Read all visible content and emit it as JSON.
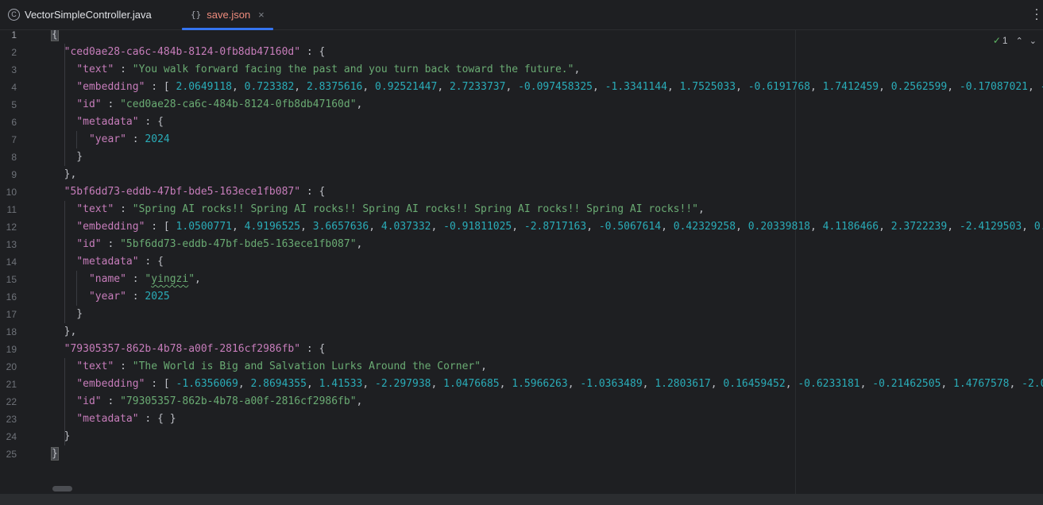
{
  "tabs": [
    {
      "label": "VectorSimpleController.java",
      "icon": "class-icon",
      "glyph": "C",
      "active": false
    },
    {
      "label": "save.json",
      "icon": "json-icon",
      "glyph": "{}",
      "active": true,
      "close": "×"
    }
  ],
  "inspection": {
    "count": "1"
  },
  "colors": {
    "key": "#c77dbb",
    "string": "#6aab73",
    "number": "#2aacb8",
    "punct": "#bcbec4",
    "accent": "#3574f0",
    "active_tab_text": "#ef8c7d"
  },
  "lines": [
    {
      "n": "1",
      "tokens": [
        {
          "t": "p",
          "v": "{"
        }
      ]
    },
    {
      "n": "2",
      "tokens": [
        {
          "t": "p",
          "v": "  "
        },
        {
          "t": "k",
          "v": "\"ced0ae28-ca6c-484b-8124-0fb8db47160d\""
        },
        {
          "t": "p",
          "v": " : {"
        }
      ]
    },
    {
      "n": "3",
      "tokens": [
        {
          "t": "p",
          "v": "    "
        },
        {
          "t": "k",
          "v": "\"text\""
        },
        {
          "t": "p",
          "v": " : "
        },
        {
          "t": "s",
          "v": "\"You walk forward facing the past and you turn back toward the future.\""
        },
        {
          "t": "p",
          "v": ","
        }
      ]
    },
    {
      "n": "4",
      "tokens": [
        {
          "t": "p",
          "v": "    "
        },
        {
          "t": "k",
          "v": "\"embedding\""
        },
        {
          "t": "p",
          "v": " : [ "
        },
        {
          "t": "n",
          "v": "2.0649118"
        },
        {
          "t": "p",
          "v": ", "
        },
        {
          "t": "n",
          "v": "0.723382"
        },
        {
          "t": "p",
          "v": ", "
        },
        {
          "t": "n",
          "v": "2.8375616"
        },
        {
          "t": "p",
          "v": ", "
        },
        {
          "t": "n",
          "v": "0.92521447"
        },
        {
          "t": "p",
          "v": ", "
        },
        {
          "t": "n",
          "v": "2.7233737"
        },
        {
          "t": "p",
          "v": ", "
        },
        {
          "t": "n",
          "v": "-0.097458325"
        },
        {
          "t": "p",
          "v": ", "
        },
        {
          "t": "n",
          "v": "-1.3341144"
        },
        {
          "t": "p",
          "v": ", "
        },
        {
          "t": "n",
          "v": "1.7525033"
        },
        {
          "t": "p",
          "v": ", "
        },
        {
          "t": "n",
          "v": "-0.6191768"
        },
        {
          "t": "p",
          "v": ", "
        },
        {
          "t": "n",
          "v": "1.7412459"
        },
        {
          "t": "p",
          "v": ", "
        },
        {
          "t": "n",
          "v": "0.2562599"
        },
        {
          "t": "p",
          "v": ", "
        },
        {
          "t": "n",
          "v": "-0.17087021"
        },
        {
          "t": "p",
          "v": ", "
        },
        {
          "t": "n",
          "v": "-"
        }
      ]
    },
    {
      "n": "5",
      "tokens": [
        {
          "t": "p",
          "v": "    "
        },
        {
          "t": "k",
          "v": "\"id\""
        },
        {
          "t": "p",
          "v": " : "
        },
        {
          "t": "s",
          "v": "\"ced0ae28-ca6c-484b-8124-0fb8db47160d\""
        },
        {
          "t": "p",
          "v": ","
        }
      ]
    },
    {
      "n": "6",
      "tokens": [
        {
          "t": "p",
          "v": "    "
        },
        {
          "t": "k",
          "v": "\"metadata\""
        },
        {
          "t": "p",
          "v": " : {"
        }
      ]
    },
    {
      "n": "7",
      "tokens": [
        {
          "t": "p",
          "v": "      "
        },
        {
          "t": "k",
          "v": "\"year\""
        },
        {
          "t": "p",
          "v": " : "
        },
        {
          "t": "n",
          "v": "2024"
        }
      ]
    },
    {
      "n": "8",
      "tokens": [
        {
          "t": "p",
          "v": "    }"
        }
      ]
    },
    {
      "n": "9",
      "tokens": [
        {
          "t": "p",
          "v": "  },"
        }
      ]
    },
    {
      "n": "10",
      "tokens": [
        {
          "t": "p",
          "v": "  "
        },
        {
          "t": "k",
          "v": "\"5bf6dd73-eddb-47bf-bde5-163ece1fb087\""
        },
        {
          "t": "p",
          "v": " : {"
        }
      ]
    },
    {
      "n": "11",
      "tokens": [
        {
          "t": "p",
          "v": "    "
        },
        {
          "t": "k",
          "v": "\"text\""
        },
        {
          "t": "p",
          "v": " : "
        },
        {
          "t": "s",
          "v": "\"Spring AI rocks!! Spring AI rocks!! Spring AI rocks!! Spring AI rocks!! Spring AI rocks!!\""
        },
        {
          "t": "p",
          "v": ","
        }
      ]
    },
    {
      "n": "12",
      "tokens": [
        {
          "t": "p",
          "v": "    "
        },
        {
          "t": "k",
          "v": "\"embedding\""
        },
        {
          "t": "p",
          "v": " : [ "
        },
        {
          "t": "n",
          "v": "1.0500771"
        },
        {
          "t": "p",
          "v": ", "
        },
        {
          "t": "n",
          "v": "4.9196525"
        },
        {
          "t": "p",
          "v": ", "
        },
        {
          "t": "n",
          "v": "3.6657636"
        },
        {
          "t": "p",
          "v": ", "
        },
        {
          "t": "n",
          "v": "4.037332"
        },
        {
          "t": "p",
          "v": ", "
        },
        {
          "t": "n",
          "v": "-0.91811025"
        },
        {
          "t": "p",
          "v": ", "
        },
        {
          "t": "n",
          "v": "-2.8717163"
        },
        {
          "t": "p",
          "v": ", "
        },
        {
          "t": "n",
          "v": "-0.5067614"
        },
        {
          "t": "p",
          "v": ", "
        },
        {
          "t": "n",
          "v": "0.42329258"
        },
        {
          "t": "p",
          "v": ", "
        },
        {
          "t": "n",
          "v": "0.20339818"
        },
        {
          "t": "p",
          "v": ", "
        },
        {
          "t": "n",
          "v": "4.1186466"
        },
        {
          "t": "p",
          "v": ", "
        },
        {
          "t": "n",
          "v": "2.3722239"
        },
        {
          "t": "p",
          "v": ", "
        },
        {
          "t": "n",
          "v": "-2.4129503"
        },
        {
          "t": "p",
          "v": ", "
        },
        {
          "t": "n",
          "v": "0."
        }
      ]
    },
    {
      "n": "13",
      "tokens": [
        {
          "t": "p",
          "v": "    "
        },
        {
          "t": "k",
          "v": "\"id\""
        },
        {
          "t": "p",
          "v": " : "
        },
        {
          "t": "s",
          "v": "\"5bf6dd73-eddb-47bf-bde5-163ece1fb087\""
        },
        {
          "t": "p",
          "v": ","
        }
      ]
    },
    {
      "n": "14",
      "tokens": [
        {
          "t": "p",
          "v": "    "
        },
        {
          "t": "k",
          "v": "\"metadata\""
        },
        {
          "t": "p",
          "v": " : {"
        }
      ]
    },
    {
      "n": "15",
      "tokens": [
        {
          "t": "p",
          "v": "      "
        },
        {
          "t": "k",
          "v": "\"name\""
        },
        {
          "t": "p",
          "v": " : "
        },
        {
          "t": "s",
          "v": "\""
        },
        {
          "t": "sq",
          "v": "yingzi"
        },
        {
          "t": "s",
          "v": "\""
        },
        {
          "t": "p",
          "v": ","
        }
      ]
    },
    {
      "n": "16",
      "tokens": [
        {
          "t": "p",
          "v": "      "
        },
        {
          "t": "k",
          "v": "\"year\""
        },
        {
          "t": "p",
          "v": " : "
        },
        {
          "t": "n",
          "v": "2025"
        }
      ]
    },
    {
      "n": "17",
      "tokens": [
        {
          "t": "p",
          "v": "    }"
        }
      ]
    },
    {
      "n": "18",
      "tokens": [
        {
          "t": "p",
          "v": "  },"
        }
      ]
    },
    {
      "n": "19",
      "tokens": [
        {
          "t": "p",
          "v": "  "
        },
        {
          "t": "k",
          "v": "\"79305357-862b-4b78-a00f-2816cf2986fb\""
        },
        {
          "t": "p",
          "v": " : {"
        }
      ]
    },
    {
      "n": "20",
      "tokens": [
        {
          "t": "p",
          "v": "    "
        },
        {
          "t": "k",
          "v": "\"text\""
        },
        {
          "t": "p",
          "v": " : "
        },
        {
          "t": "s",
          "v": "\"The World is Big and Salvation Lurks Around the Corner\""
        },
        {
          "t": "p",
          "v": ","
        }
      ]
    },
    {
      "n": "21",
      "tokens": [
        {
          "t": "p",
          "v": "    "
        },
        {
          "t": "k",
          "v": "\"embedding\""
        },
        {
          "t": "p",
          "v": " : [ "
        },
        {
          "t": "n",
          "v": "-1.6356069"
        },
        {
          "t": "p",
          "v": ", "
        },
        {
          "t": "n",
          "v": "2.8694355"
        },
        {
          "t": "p",
          "v": ", "
        },
        {
          "t": "n",
          "v": "1.41533"
        },
        {
          "t": "p",
          "v": ", "
        },
        {
          "t": "n",
          "v": "-2.297938"
        },
        {
          "t": "p",
          "v": ", "
        },
        {
          "t": "n",
          "v": "1.0476685"
        },
        {
          "t": "p",
          "v": ", "
        },
        {
          "t": "n",
          "v": "1.5966263"
        },
        {
          "t": "p",
          "v": ", "
        },
        {
          "t": "n",
          "v": "-1.0363489"
        },
        {
          "t": "p",
          "v": ", "
        },
        {
          "t": "n",
          "v": "1.2803617"
        },
        {
          "t": "p",
          "v": ", "
        },
        {
          "t": "n",
          "v": "0.16459452"
        },
        {
          "t": "p",
          "v": ", "
        },
        {
          "t": "n",
          "v": "-0.6233181"
        },
        {
          "t": "p",
          "v": ", "
        },
        {
          "t": "n",
          "v": "-0.21462505"
        },
        {
          "t": "p",
          "v": ", "
        },
        {
          "t": "n",
          "v": "1.4767578"
        },
        {
          "t": "p",
          "v": ", "
        },
        {
          "t": "n",
          "v": "-2.0"
        }
      ]
    },
    {
      "n": "22",
      "tokens": [
        {
          "t": "p",
          "v": "    "
        },
        {
          "t": "k",
          "v": "\"id\""
        },
        {
          "t": "p",
          "v": " : "
        },
        {
          "t": "s",
          "v": "\"79305357-862b-4b78-a00f-2816cf2986fb\""
        },
        {
          "t": "p",
          "v": ","
        }
      ]
    },
    {
      "n": "23",
      "tokens": [
        {
          "t": "p",
          "v": "    "
        },
        {
          "t": "k",
          "v": "\"metadata\""
        },
        {
          "t": "p",
          "v": " : { }"
        }
      ]
    },
    {
      "n": "24",
      "tokens": [
        {
          "t": "p",
          "v": "  }"
        }
      ]
    },
    {
      "n": "25",
      "tokens": [
        {
          "t": "p",
          "v": "}"
        }
      ]
    }
  ]
}
